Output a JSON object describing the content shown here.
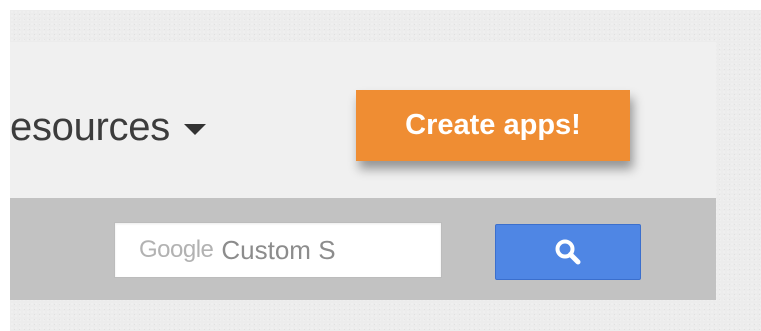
{
  "nav": {
    "resources_label": "esources",
    "create_button_label": "Create apps!"
  },
  "search": {
    "brand_text": "Google",
    "placeholder_text": "Custom S"
  },
  "icons": {
    "dropdown": "caret-down-icon",
    "search": "magnifier-icon"
  },
  "colors": {
    "create_button": "#ef8d33",
    "search_button": "#4f86e4",
    "nav_background": "#f0f0f0",
    "search_bar_background": "#c2c2c2"
  }
}
